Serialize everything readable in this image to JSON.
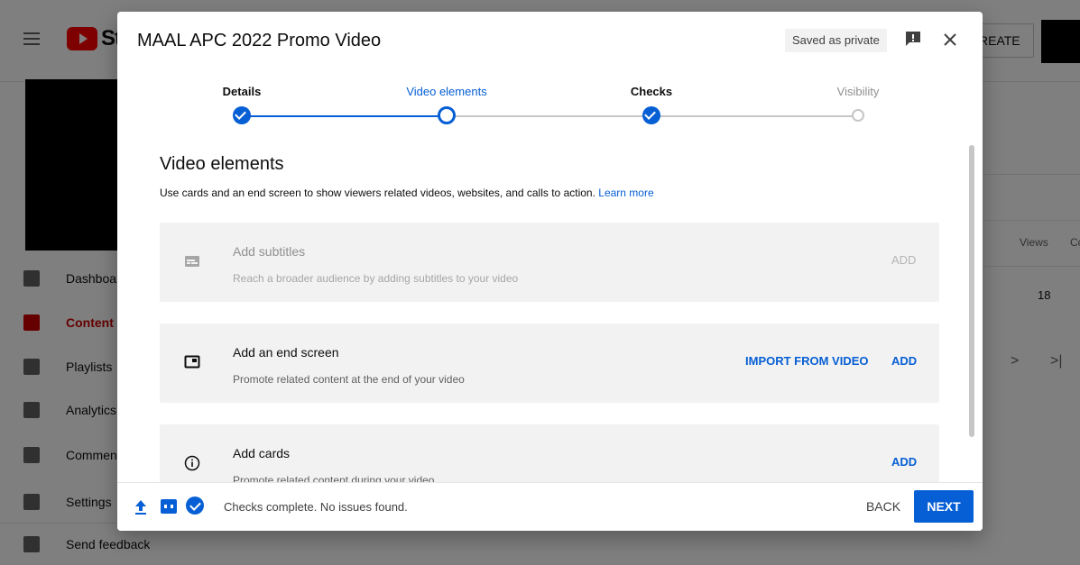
{
  "background": {
    "logo_text": "St",
    "create_label": "REATE",
    "sidebar": [
      {
        "label": "Dashboar",
        "name": "dashboard",
        "active": false
      },
      {
        "label": "Content",
        "name": "content",
        "active": true
      },
      {
        "label": "Playlists",
        "name": "playlists",
        "active": false
      },
      {
        "label": "Analytics",
        "name": "analytics",
        "active": false
      },
      {
        "label": "Commen",
        "name": "comments",
        "active": false
      },
      {
        "label": "Settings",
        "name": "settings",
        "active": false
      },
      {
        "label": "Send feedback",
        "name": "send-feedback",
        "active": false
      }
    ],
    "views_header": "Views",
    "views_header_cut": "Co",
    "views_value": "18",
    "pager_next": ">",
    "pager_last": ">|"
  },
  "dialog": {
    "title": "MAAL APC 2022 Promo Video",
    "saved_chip": "Saved as private",
    "steps": [
      {
        "label": "Details",
        "state": "done"
      },
      {
        "label": "Video elements",
        "state": "current"
      },
      {
        "label": "Checks",
        "state": "done"
      },
      {
        "label": "Visibility",
        "state": "future"
      }
    ],
    "section_title": "Video elements",
    "section_desc": "Use cards and an end screen to show viewers related videos, websites, and calls to action.",
    "learn_more": "Learn more",
    "elements": [
      {
        "title": "Add subtitles",
        "desc": "Reach a broader audience by adding subtitles to your video",
        "icon": "subtitles-icon",
        "disabled": true,
        "add_label": "ADD"
      },
      {
        "title": "Add an end screen",
        "desc": "Promote related content at the end of your video",
        "icon": "end-screen-icon",
        "disabled": false,
        "import_label": "IMPORT FROM VIDEO",
        "add_label": "ADD"
      },
      {
        "title": "Add cards",
        "desc": "Promote related content during your video",
        "icon": "info-icon",
        "disabled": false,
        "add_label": "ADD"
      }
    ],
    "footer": {
      "status": "Checks complete. No issues found.",
      "back_label": "BACK",
      "next_label": "NEXT"
    }
  },
  "colors": {
    "accent": "#065fd4",
    "brand": "#ff0000"
  }
}
